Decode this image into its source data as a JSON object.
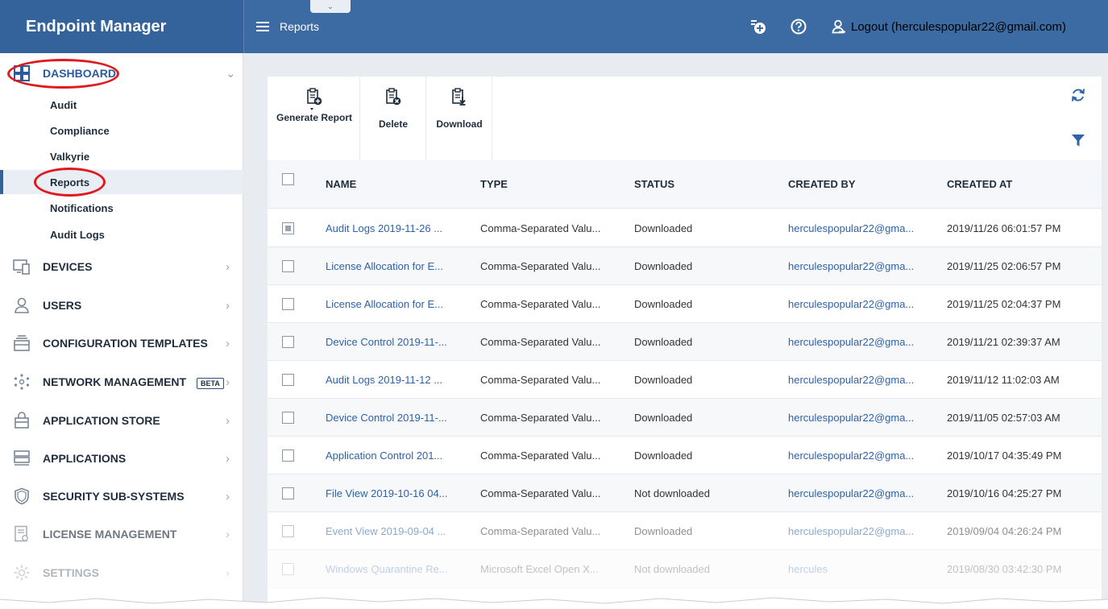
{
  "app": {
    "title": "Endpoint Manager"
  },
  "topbar": {
    "title": "Reports",
    "logout_label": "Logout (herculespopular22@gmail.com)"
  },
  "sidebar": {
    "dashboard": {
      "label": "DASHBOARD",
      "items": [
        "Audit",
        "Compliance",
        "Valkyrie",
        "Reports",
        "Notifications",
        "Audit Logs"
      ],
      "active": "Reports"
    },
    "sections": [
      {
        "label": "DEVICES",
        "icon": "devices-icon"
      },
      {
        "label": "USERS",
        "icon": "user-icon"
      },
      {
        "label": "CONFIGURATION TEMPLATES",
        "icon": "templates-icon"
      },
      {
        "label": "NETWORK MANAGEMENT",
        "icon": "network-icon",
        "badge": "BETA"
      },
      {
        "label": "APPLICATION STORE",
        "icon": "store-icon"
      },
      {
        "label": "APPLICATIONS",
        "icon": "applications-icon"
      },
      {
        "label": "SECURITY SUB-SYSTEMS",
        "icon": "shield-icon"
      },
      {
        "label": "LICENSE MANAGEMENT",
        "icon": "license-icon"
      },
      {
        "label": "SETTINGS",
        "icon": "gear-icon"
      }
    ]
  },
  "toolbar": {
    "generate_label": "Generate Report",
    "delete_label": "Delete",
    "download_label": "Download"
  },
  "table": {
    "columns": [
      "NAME",
      "TYPE",
      "STATUS",
      "CREATED BY",
      "CREATED AT"
    ],
    "rows": [
      {
        "name": "Audit Logs 2019-11-26 ...",
        "type": "Comma-Separated Valu...",
        "status": "Downloaded",
        "created_by": "herculespopular22@gma...",
        "created_at": "2019/11/26 06:01:57 PM",
        "checked": "partial"
      },
      {
        "name": "License Allocation for E...",
        "type": "Comma-Separated Valu...",
        "status": "Downloaded",
        "created_by": "herculespopular22@gma...",
        "created_at": "2019/11/25 02:06:57 PM"
      },
      {
        "name": "License Allocation for E...",
        "type": "Comma-Separated Valu...",
        "status": "Downloaded",
        "created_by": "herculespopular22@gma...",
        "created_at": "2019/11/25 02:04:37 PM"
      },
      {
        "name": "Device Control 2019-11-...",
        "type": "Comma-Separated Valu...",
        "status": "Downloaded",
        "created_by": "herculespopular22@gma...",
        "created_at": "2019/11/21 02:39:37 AM"
      },
      {
        "name": "Audit Logs 2019-11-12 ...",
        "type": "Comma-Separated Valu...",
        "status": "Downloaded",
        "created_by": "herculespopular22@gma...",
        "created_at": "2019/11/12 11:02:03 AM"
      },
      {
        "name": "Device Control 2019-11-...",
        "type": "Comma-Separated Valu...",
        "status": "Downloaded",
        "created_by": "herculespopular22@gma...",
        "created_at": "2019/11/05 02:57:03 AM"
      },
      {
        "name": "Application Control 201...",
        "type": "Comma-Separated Valu...",
        "status": "Downloaded",
        "created_by": "herculespopular22@gma...",
        "created_at": "2019/10/17 04:35:49 PM"
      },
      {
        "name": "File View 2019-10-16 04...",
        "type": "Comma-Separated Valu...",
        "status": "Not downloaded",
        "created_by": "herculespopular22@gma...",
        "created_at": "2019/10/16 04:25:27 PM"
      },
      {
        "name": "Event View 2019-09-04 ...",
        "type": "Comma-Separated Valu...",
        "status": "Downloaded",
        "created_by": "herculespopular22@gma...",
        "created_at": "2019/09/04 04:26:24 PM"
      },
      {
        "name": "Windows Quarantine Re...",
        "type": "Microsoft Excel Open X...",
        "status": "Not downloaded",
        "created_by": "hercules",
        "created_at": "2019/08/30 03:42:30 PM"
      }
    ]
  },
  "colors": {
    "brand": "#34629a",
    "topbar": "#3c6aa2",
    "link": "#2f62a8",
    "annotation": "#e0191f"
  }
}
